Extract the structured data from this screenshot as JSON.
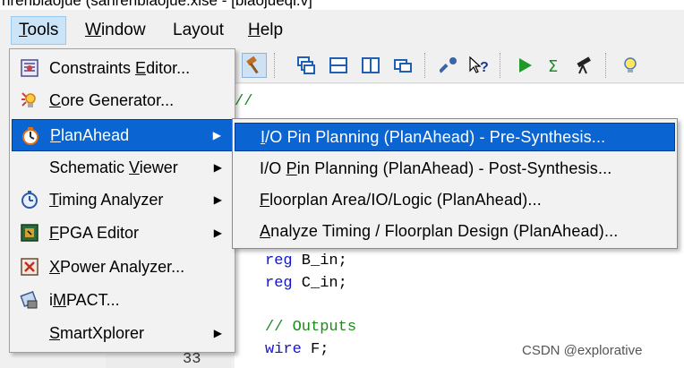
{
  "window": {
    "title": "nrenbiaojue (sanrenbiaojue.xise - [biaojueqi.v]"
  },
  "menubar": {
    "items": [
      {
        "label": "Tools",
        "mnemonic": "T",
        "rest": "ools",
        "active": true
      },
      {
        "label": "Window",
        "mnemonic": "W",
        "rest": "indow"
      },
      {
        "label": "Layout",
        "mnemonic": "",
        "rest": "Layout"
      },
      {
        "label": "Help",
        "mnemonic": "H",
        "rest": "elp"
      }
    ]
  },
  "toolbar": {
    "icons": [
      "hammer-icon",
      "cascade-windows-icon",
      "tile-horizontal-icon",
      "tile-vertical-icon",
      "window-restore-icon",
      "wrench-icon",
      "help-pointer-icon",
      "run-icon",
      "sigma-icon",
      "telescope-icon",
      "lightbulb-icon"
    ]
  },
  "tools_menu": {
    "items": [
      {
        "name": "constraints-editor",
        "pre": "Constraints ",
        "u": "E",
        "post": "ditor...",
        "icon": "constraints-icon",
        "submenu": false
      },
      {
        "name": "core-generator",
        "pre": "",
        "u": "C",
        "post": "ore Generator...",
        "icon": "core-generator-icon",
        "submenu": false
      },
      {
        "name": "planahead",
        "pre": "",
        "u": "P",
        "post": "lanAhead",
        "icon": "planahead-icon",
        "submenu": true,
        "highlight": true
      },
      {
        "name": "schematic-viewer",
        "pre": "Schematic ",
        "u": "V",
        "post": "iewer",
        "icon": "",
        "submenu": true
      },
      {
        "name": "timing-analyzer",
        "pre": "",
        "u": "T",
        "post": "iming Analyzer",
        "icon": "stopwatch-icon",
        "submenu": true
      },
      {
        "name": "fpga-editor",
        "pre": "",
        "u": "F",
        "post": "PGA Editor",
        "icon": "fpga-editor-icon",
        "submenu": true
      },
      {
        "name": "xpower-analyzer",
        "pre": "",
        "u": "X",
        "post": "Power Analyzer...",
        "icon": "xpower-icon",
        "submenu": false
      },
      {
        "name": "impact",
        "pre": "i",
        "u": "M",
        "post": "PACT...",
        "icon": "impact-icon",
        "submenu": false
      },
      {
        "name": "smartxplorer",
        "pre": "",
        "u": "S",
        "post": "martXplorer",
        "icon": "",
        "submenu": true
      }
    ]
  },
  "planahead_submenu": {
    "items": [
      {
        "name": "io-pin-planning-pre-synthesis",
        "pre": "",
        "u": "I",
        "post": "/O Pin Planning (PlanAhead) - Pre-Synthesis...",
        "highlight": true
      },
      {
        "name": "io-pin-planning-post-synthesis",
        "pre": "I/O ",
        "u": "P",
        "post": "in Planning (PlanAhead) - Post-Synthesis..."
      },
      {
        "name": "floorplan-area-io-logic",
        "pre": "",
        "u": "F",
        "post": "loorplan Area/IO/Logic (PlanAhead)..."
      },
      {
        "name": "analyze-timing-floorplan-design",
        "pre": "",
        "u": "A",
        "post": "nalyze Timing / Floorplan Design (PlanAhead)..."
      }
    ]
  },
  "editor": {
    "comment_top": "//",
    "lines": [
      {
        "kw": "reg",
        "rest": " B_in;"
      },
      {
        "kw": "reg",
        "rest": " C_in;"
      },
      {
        "comment": "// Outputs"
      },
      {
        "kw": "wire",
        "rest": " F;"
      }
    ],
    "line_number_partial": "33"
  },
  "watermark": "CSDN @explorative"
}
